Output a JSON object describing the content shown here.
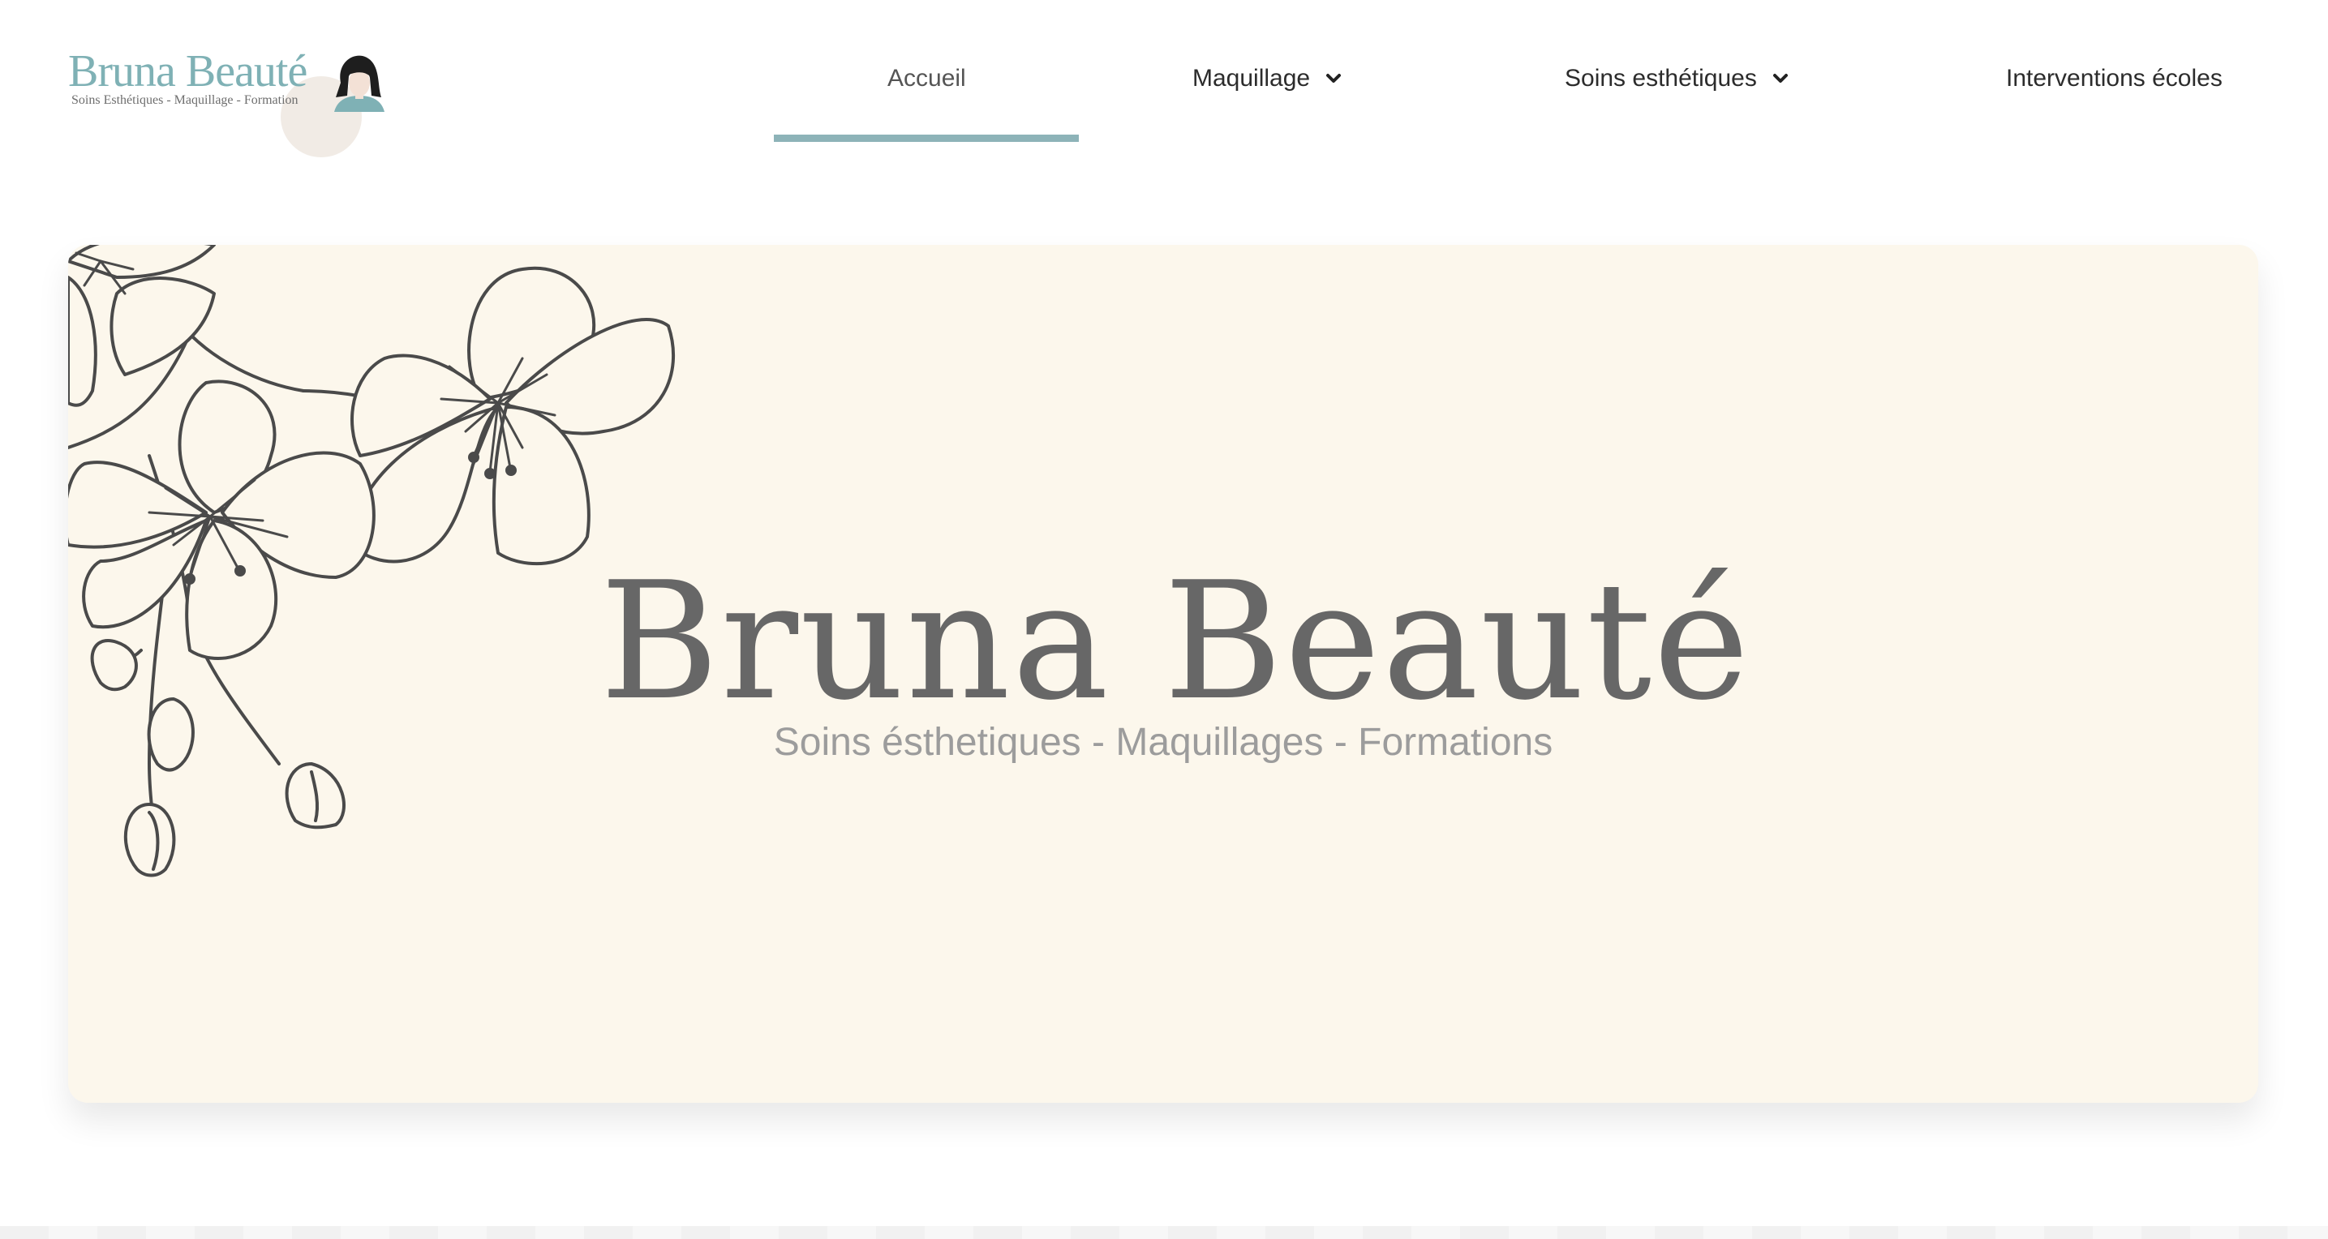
{
  "brand": {
    "logo_title": "Bruna Beauté",
    "logo_subtitle": "Soins Esthétiques - Maquillage - Formation"
  },
  "nav": {
    "items": [
      {
        "label": "Accueil",
        "active": true,
        "has_dropdown": false
      },
      {
        "label": "Maquillage",
        "active": false,
        "has_dropdown": true
      },
      {
        "label": "Soins esthétiques",
        "active": false,
        "has_dropdown": true
      },
      {
        "label": "Interventions écoles",
        "active": false,
        "has_dropdown": false
      }
    ]
  },
  "hero": {
    "title": "Bruna Beauté",
    "subtitle": "Soins ésthetiques - Maquillages - Formations"
  },
  "colors": {
    "accent": "#8db3b8",
    "hero_bg": "#fcf7ec",
    "title_text": "#676767",
    "subtitle_text": "#9c9c9c",
    "logo_teal": "#7fb1b5"
  },
  "icons": {
    "dropdown": "chevron-down-icon",
    "hero_decoration": "flower-illustration"
  }
}
